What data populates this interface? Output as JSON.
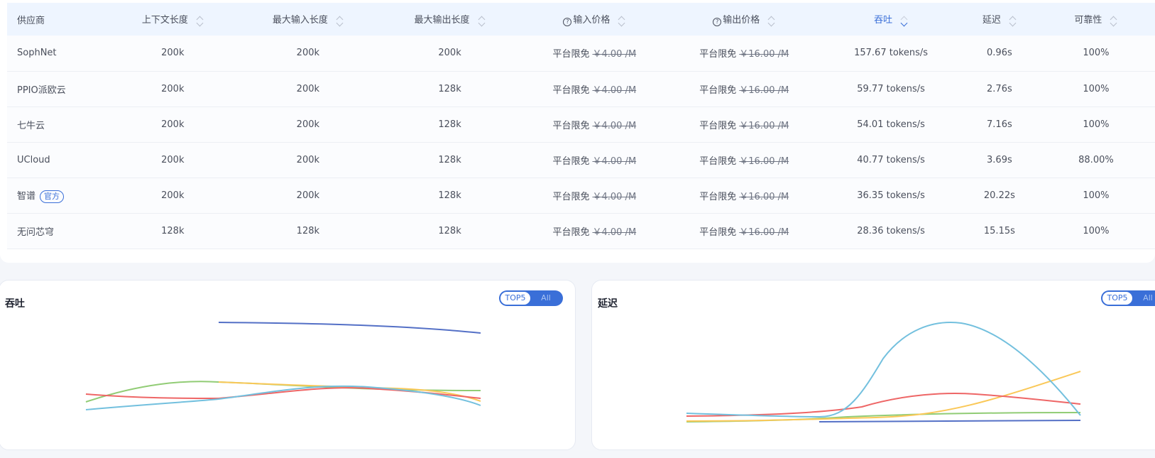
{
  "table": {
    "headers": {
      "provider": "供应商",
      "context": "上下文长度",
      "max_input": "最大输入长度",
      "max_output": "最大输出长度",
      "input_price": "输入价格",
      "output_price": "输出价格",
      "throughput": "吞吐",
      "latency": "延迟",
      "reliability": "可靠性"
    },
    "free_label": "平台限免",
    "rows": [
      {
        "provider": "SophNet",
        "context": "200k",
        "max_input": "200k",
        "max_output": "200k",
        "input_price": "￥4.00 /M",
        "output_price": "￥16.00 /M",
        "throughput": "157.67 tokens/s",
        "latency": "0.96s",
        "reliability": "100%"
      },
      {
        "provider": "PPIO派欧云",
        "context": "200k",
        "max_input": "200k",
        "max_output": "128k",
        "input_price": "￥4.00 /M",
        "output_price": "￥16.00 /M",
        "throughput": "59.77 tokens/s",
        "latency": "2.76s",
        "reliability": "100%"
      },
      {
        "provider": "七牛云",
        "context": "200k",
        "max_input": "200k",
        "max_output": "128k",
        "input_price": "￥4.00 /M",
        "output_price": "￥16.00 /M",
        "throughput": "54.01 tokens/s",
        "latency": "7.16s",
        "reliability": "100%"
      },
      {
        "provider": "UCloud",
        "context": "200k",
        "max_input": "200k",
        "max_output": "128k",
        "input_price": "￥4.00 /M",
        "output_price": "￥16.00 /M",
        "throughput": "40.77 tokens/s",
        "latency": "3.69s",
        "reliability": "88.00%"
      },
      {
        "provider": "智谱",
        "badge": "官方",
        "context": "200k",
        "max_input": "200k",
        "max_output": "128k",
        "input_price": "￥4.00 /M",
        "output_price": "￥16.00 /M",
        "throughput": "36.35 tokens/s",
        "latency": "20.22s",
        "reliability": "100%"
      },
      {
        "provider": "无问芯穹",
        "context": "128k",
        "max_input": "128k",
        "max_output": "128k",
        "input_price": "￥4.00 /M",
        "output_price": "￥16.00 /M",
        "throughput": "28.36 tokens/s",
        "latency": "15.15s",
        "reliability": "100%"
      }
    ]
  },
  "charts": {
    "throughput": {
      "title": "吞吐",
      "toggle_on": "TOP5",
      "toggle_off": "All"
    },
    "latency": {
      "title": "延迟",
      "toggle_on": "TOP5",
      "toggle_off": "All"
    }
  },
  "colors": {
    "accent": "#3a6fd8",
    "series": [
      "#5470c6",
      "#91cc75",
      "#fac858",
      "#ee6666",
      "#73c0de"
    ]
  }
}
